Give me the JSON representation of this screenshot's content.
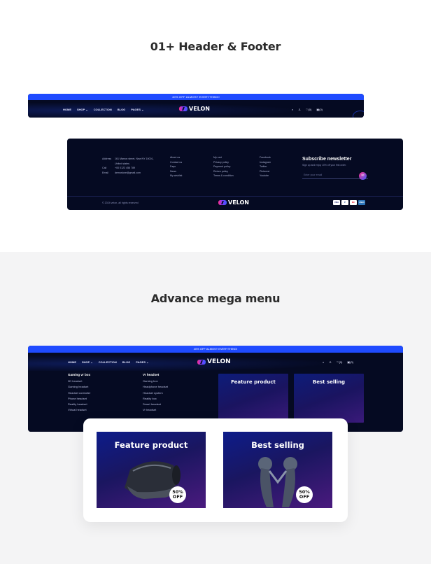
{
  "section1": {
    "title": "01+ Header & Footer"
  },
  "section2": {
    "title": "Advance mega menu"
  },
  "header": {
    "promo": "40% OFF ALMOST EVERYTHING!",
    "nav": [
      "HOME",
      "SHOP",
      "COLLECTION",
      "BLOG",
      "PAGES"
    ],
    "logo": "VELON",
    "icons": [
      "search-icon",
      "user-icon",
      "heart-icon",
      "cart-icon"
    ],
    "wishlist_count": "(0)",
    "cart_count": "(0)"
  },
  "footer": {
    "address_label": "Address",
    "address_value": "161 Marron street, New NY 10001, United states",
    "call_label": "Call",
    "call_value": "+00 0123 456 789",
    "email_label": "Email",
    "email_value": "demostore@gmail.com",
    "links1": [
      "About us",
      "Contact us",
      "Faqs",
      "News",
      "My wishlist"
    ],
    "links2": [
      "My cart",
      "Privacy policy",
      "Payment policy",
      "Return policy",
      "Terms & condition"
    ],
    "social": [
      "Facebook",
      "Instagram",
      "Twitter",
      "Pinterest",
      "Youtube"
    ],
    "newsletter_title": "Subscribe newsletter",
    "newsletter_sub": "Sign up and enjoy 10% off your first order.",
    "email_placeholder": "Enter your email",
    "copyright": "© 2024 velon, all rights reserved",
    "payments": [
      "VISA",
      "P",
      "MC",
      "AMEX"
    ],
    "colors": {
      "accent": "#1f4bff",
      "bg": "#050a22"
    }
  },
  "mega": {
    "col1_title": "Gaming vr box",
    "col1_items": [
      "3D headset",
      "Gaming headset",
      "Headset controller",
      "Phone headset",
      "Reality headset",
      "Virtual headset"
    ],
    "col2_title": "Vr headset",
    "col2_items": [
      "Gaming box",
      "Headphone headset",
      "Headset system",
      "Reality box",
      "Smart headset",
      "Vr headset"
    ],
    "card1_title": "Feature product",
    "card2_title": "Best selling",
    "badge_line1": "50%",
    "badge_line2": "OFF"
  }
}
